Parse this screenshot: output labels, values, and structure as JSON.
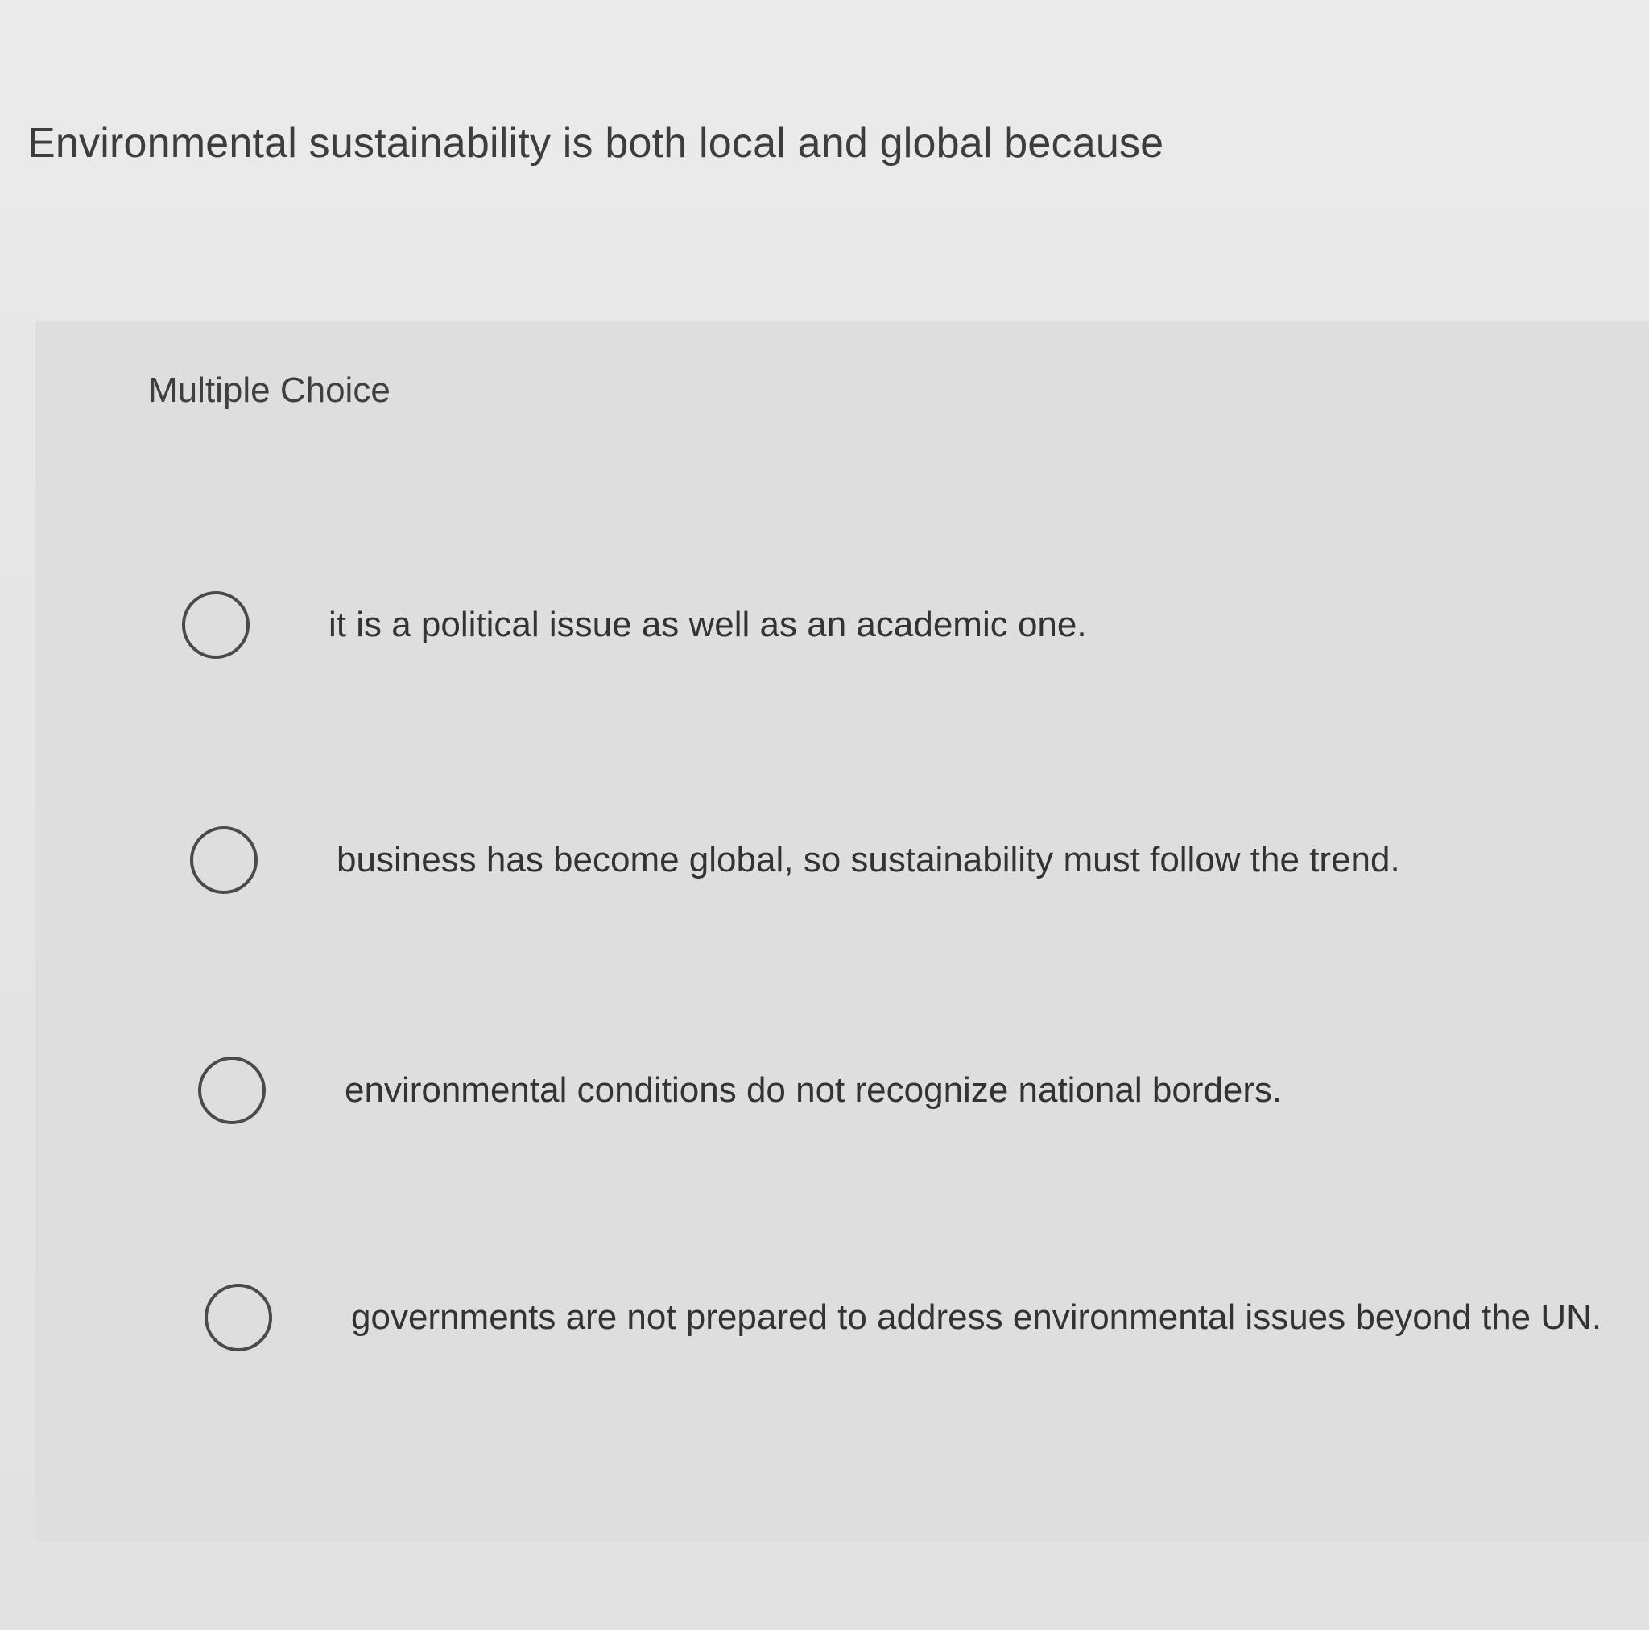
{
  "question": {
    "stem": "Environmental sustainability is both local and global because",
    "type_label": "Multiple Choice",
    "choices": [
      {
        "label": "it is a political issue as well as an academic one."
      },
      {
        "label": "business has become global, so sustainability must follow the trend."
      },
      {
        "label": "environmental conditions do not recognize national borders."
      },
      {
        "label": "governments are not prepared to address environmental issues beyond the UN."
      }
    ]
  }
}
